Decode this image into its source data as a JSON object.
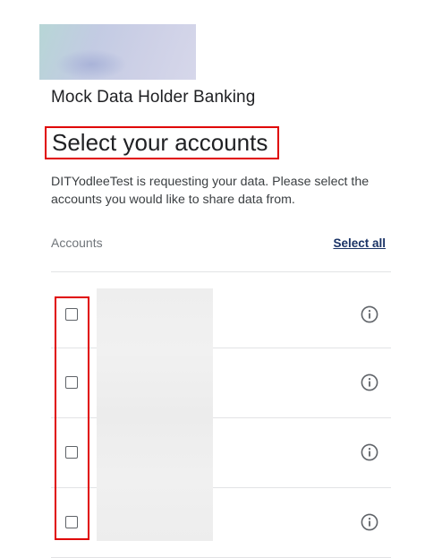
{
  "bank": {
    "name": "Mock Data Holder Banking"
  },
  "page": {
    "title": "Select your accounts",
    "description": "DITYodleeTest is requesting your data. Please select the accounts you would like to share data from."
  },
  "accounts": {
    "label": "Accounts",
    "select_all_label": "Select all",
    "items": [
      {
        "checked": false,
        "info_icon": "info-icon"
      },
      {
        "checked": false,
        "info_icon": "info-icon"
      },
      {
        "checked": false,
        "info_icon": "info-icon"
      },
      {
        "checked": false,
        "info_icon": "info-icon"
      }
    ]
  },
  "colors": {
    "highlight": "#e00000",
    "link": "#1a3366",
    "divider": "#e2e3e5"
  }
}
